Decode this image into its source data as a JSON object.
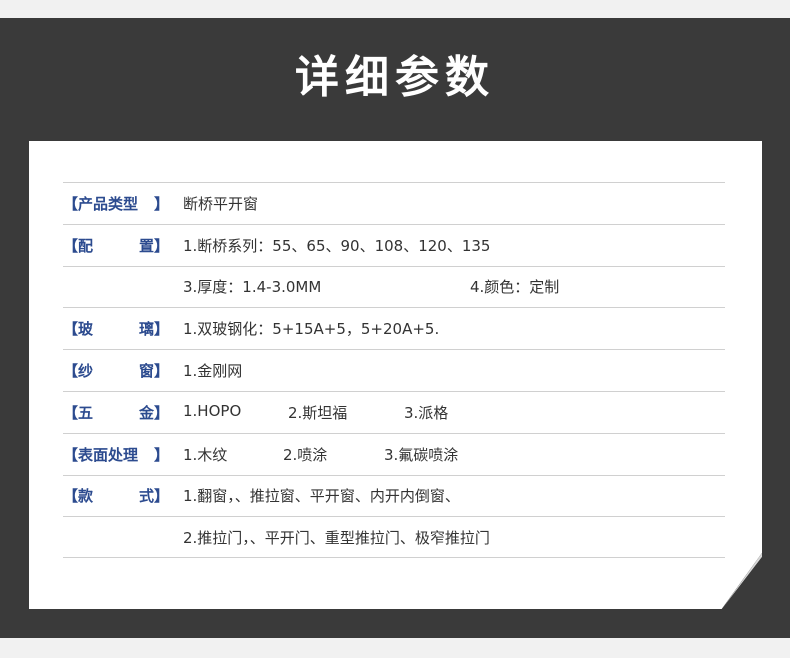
{
  "title": "详细参数",
  "rows": [
    {
      "label_open": "【产品类型",
      "label_close": "】",
      "cells": [
        "断桥平开窗"
      ]
    },
    {
      "label_open": "【配",
      "label_close": "置】",
      "cells": [
        "1.断桥系列：55、65、90、108、120、135"
      ]
    },
    {
      "label_open": "",
      "label_close": "",
      "cells": [
        "3.厚度：1.4-3.0MM",
        "4.颜色：定制"
      ]
    },
    {
      "label_open": "【玻",
      "label_close": "璃】",
      "cells": [
        "1.双玻钢化：5+15A+5，5+20A+5."
      ]
    },
    {
      "label_open": "【纱",
      "label_close": "窗】",
      "cells": [
        "1.金刚网"
      ]
    },
    {
      "label_open": "【五",
      "label_close": "金】",
      "cells": [
        "1.HOPO",
        "2.斯坦福",
        "3.派格"
      ]
    },
    {
      "label_open": "【表面处理",
      "label_close": "】",
      "cells": [
        "1.木纹",
        "2.喷涂",
        "3.氟碳喷涂"
      ]
    },
    {
      "label_open": "【款",
      "label_close": "式】",
      "cells": [
        "1.翻窗，、推拉窗、平开窗、内开内倒窗、"
      ]
    },
    {
      "label_open": "",
      "label_close": "",
      "cells": [
        "2.推拉门，、平开门、重型推拉门、极窄推拉门"
      ]
    }
  ],
  "colors": {
    "label": "#2c4b8f",
    "band": "#3a3a3a",
    "card": "#ffffff"
  }
}
